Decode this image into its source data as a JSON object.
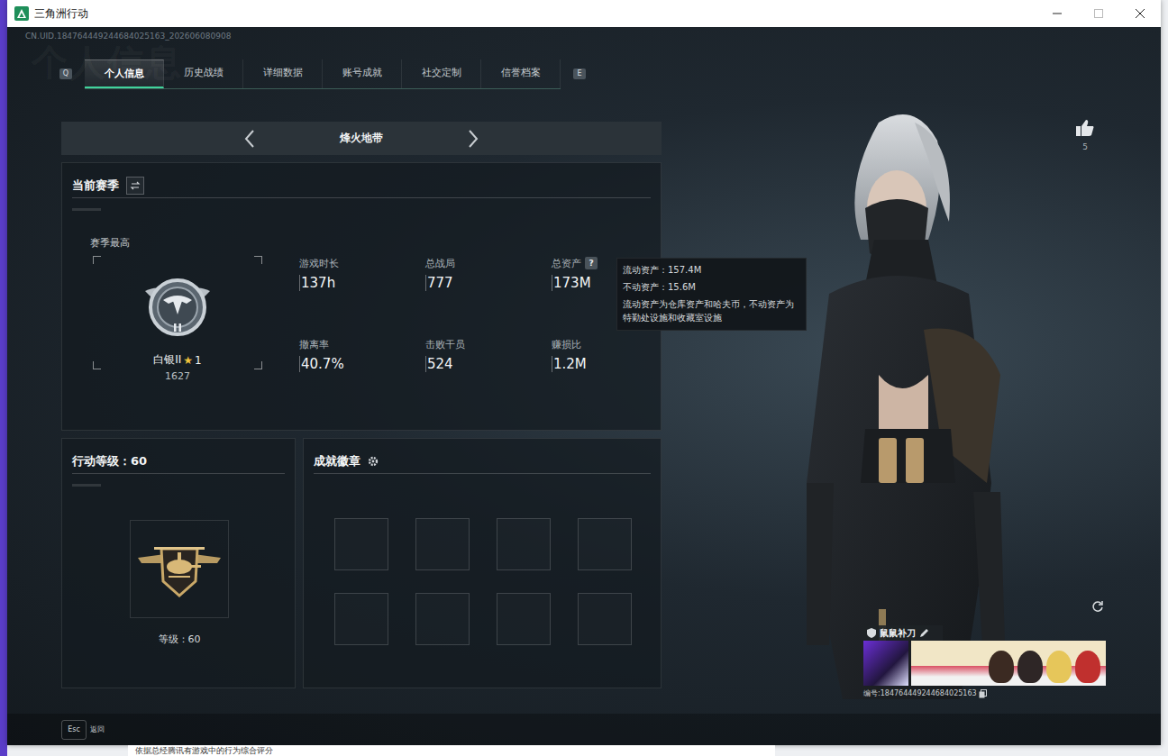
{
  "window": {
    "title": "三角洲行动"
  },
  "uid": "CN.UID.184764449244684025163_202606080908",
  "watermark": "个人信息",
  "tab_keys": {
    "prev": "Q",
    "next": "E"
  },
  "tabs": [
    {
      "label": "个人信息",
      "selected": true
    },
    {
      "label": "历史战绩",
      "selected": false
    },
    {
      "label": "详细数据",
      "selected": false
    },
    {
      "label": "账号成就",
      "selected": false
    },
    {
      "label": "社交定制",
      "selected": false
    },
    {
      "label": "信誉档案",
      "selected": false
    }
  ],
  "mode": {
    "label": "烽火地带"
  },
  "season": {
    "title": "当前赛季",
    "best_label": "赛季最高",
    "rank": "白银II",
    "star": "★",
    "rank_stars": "1",
    "points": "1627"
  },
  "stats": [
    {
      "label": "游戏时长",
      "value": "137h",
      "help": ""
    },
    {
      "label": "总战局",
      "value": "777",
      "help": ""
    },
    {
      "label": "总资产",
      "value": "173M",
      "help": "?"
    },
    {
      "label": "撤离率",
      "value": "40.7%",
      "help": ""
    },
    {
      "label": "击败干员",
      "value": "524",
      "help": ""
    },
    {
      "label": "赚损比",
      "value": "1.2M",
      "help": ""
    }
  ],
  "tooltip": {
    "lines": [
      "流动资产：157.4M",
      "不动资产：15.6M",
      "流动资产为仓库资产和哈夫币，不动资产为特勤处设施和收藏室设施"
    ]
  },
  "level": {
    "title": "行动等级：60",
    "caption": "等级：60"
  },
  "badges": {
    "title": "成就徽章",
    "slots": [
      {
        "filled": false
      },
      {
        "filled": false
      },
      {
        "filled": false
      },
      {
        "filled": false
      },
      {
        "filled": false
      },
      {
        "filled": false
      },
      {
        "filled": false
      },
      {
        "filled": false
      }
    ]
  },
  "likes": {
    "count": "5"
  },
  "profile": {
    "name": "鼠鼠补刀",
    "id": "编号:184764449244684025163"
  },
  "footer": {
    "key": "Esc",
    "label": "返回"
  },
  "desktop_text": "依据总经腾讯有游戏中的行为综合评分"
}
